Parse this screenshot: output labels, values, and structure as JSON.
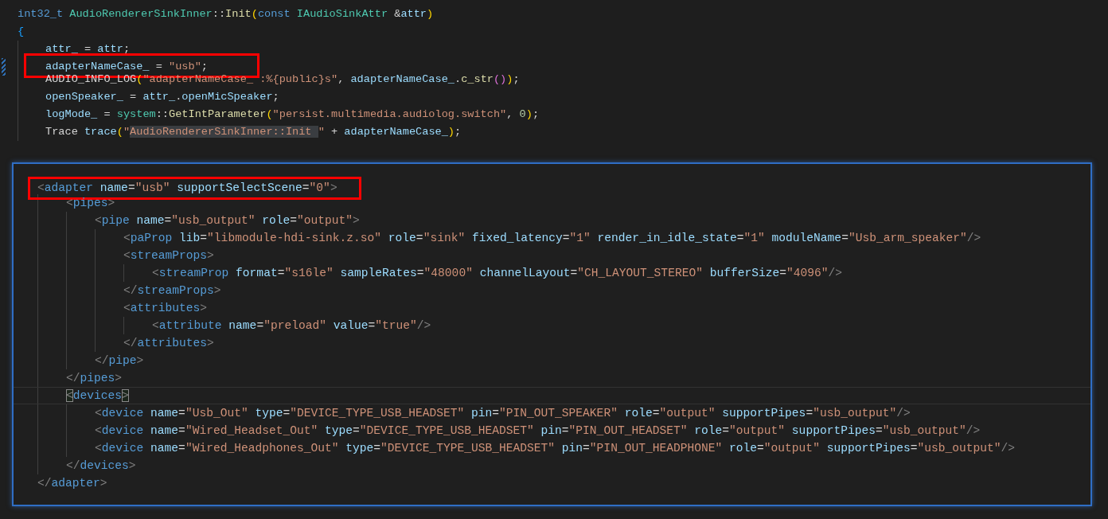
{
  "cpp_code": {
    "lines": [
      {
        "boxed": false,
        "tokens": [
          {
            "text": "int32_t ",
            "kind": "keyword"
          },
          {
            "text": "AudioRendererSinkInner",
            "kind": "type"
          },
          {
            "text": "::",
            "kind": "plain"
          },
          {
            "text": "Init",
            "kind": "function"
          },
          {
            "text": "(",
            "kind": "paren"
          },
          {
            "text": "const ",
            "kind": "keyword"
          },
          {
            "text": "IAudioSinkAttr",
            "kind": "type"
          },
          {
            "text": " &",
            "kind": "plain"
          },
          {
            "text": "attr",
            "kind": "variable"
          },
          {
            "text": ")",
            "kind": "paren"
          }
        ]
      },
      {
        "boxed": false,
        "tokens": [
          {
            "text": "{",
            "kind": "brace"
          }
        ],
        "children": [
          {
            "boxed": false,
            "tokens": [
              {
                "text": "attr_",
                "kind": "variable"
              },
              {
                "text": " = ",
                "kind": "plain"
              },
              {
                "text": "attr",
                "kind": "variable"
              },
              {
                "text": ";",
                "kind": "plain"
              }
            ]
          },
          {
            "boxed": true,
            "tokens": [
              {
                "text": "adapterNameCase_",
                "kind": "variable"
              },
              {
                "text": " = ",
                "kind": "plain"
              },
              {
                "text": "\"usb\"",
                "kind": "string"
              },
              {
                "text": ";",
                "kind": "plain"
              }
            ]
          },
          {
            "boxed": false,
            "tokens": [
              {
                "text": "AUDIO_INFO_LOG",
                "kind": "plain"
              },
              {
                "text": "(",
                "kind": "paren"
              },
              {
                "text": "\"adapterNameCase_ :%{public}s\"",
                "kind": "string"
              },
              {
                "text": ", ",
                "kind": "plain"
              },
              {
                "text": "adapterNameCase_",
                "kind": "variable"
              },
              {
                "text": ".",
                "kind": "plain"
              },
              {
                "text": "c_str",
                "kind": "function"
              },
              {
                "text": "()",
                "kind": "paren2"
              },
              {
                "text": ")",
                "kind": "paren"
              },
              {
                "text": ";",
                "kind": "plain"
              }
            ]
          },
          {
            "boxed": false,
            "tokens": [
              {
                "text": "openSpeaker_",
                "kind": "variable"
              },
              {
                "text": " = ",
                "kind": "plain"
              },
              {
                "text": "attr_",
                "kind": "variable"
              },
              {
                "text": ".",
                "kind": "plain"
              },
              {
                "text": "openMicSpeaker",
                "kind": "variable"
              },
              {
                "text": ";",
                "kind": "plain"
              }
            ]
          },
          {
            "boxed": false,
            "tokens": [
              {
                "text": "logMode_",
                "kind": "variable"
              },
              {
                "text": " = ",
                "kind": "plain"
              },
              {
                "text": "system",
                "kind": "type"
              },
              {
                "text": "::",
                "kind": "plain"
              },
              {
                "text": "GetIntParameter",
                "kind": "function"
              },
              {
                "text": "(",
                "kind": "paren"
              },
              {
                "text": "\"persist.multimedia.audiolog.switch\"",
                "kind": "string"
              },
              {
                "text": ", ",
                "kind": "plain"
              },
              {
                "text": "0",
                "kind": "number"
              },
              {
                "text": ")",
                "kind": "paren"
              },
              {
                "text": ";",
                "kind": "plain"
              }
            ]
          },
          {
            "boxed": false,
            "tokens": [
              {
                "text": "Trace ",
                "kind": "plain"
              },
              {
                "text": "trace",
                "kind": "variable"
              },
              {
                "text": "(",
                "kind": "paren"
              },
              {
                "text": "\"",
                "kind": "string"
              },
              {
                "text": "AudioRendererSinkInner::Init ",
                "kind": "match"
              },
              {
                "text": "\"",
                "kind": "string"
              },
              {
                "text": " + ",
                "kind": "plain"
              },
              {
                "text": "adapterNameCase_",
                "kind": "variable"
              },
              {
                "text": ")",
                "kind": "paren"
              },
              {
                "text": ";",
                "kind": "plain"
              }
            ]
          }
        ]
      }
    ]
  },
  "xml_code": {
    "lines": [
      {
        "boxed": true,
        "current": false,
        "tokens": [
          {
            "text": "<",
            "kind": "punct"
          },
          {
            "text": "adapter",
            "kind": "tag"
          },
          {
            "text": " name",
            "kind": "attr"
          },
          {
            "text": "=",
            "kind": "plain"
          },
          {
            "text": "\"usb\"",
            "kind": "string"
          },
          {
            "text": " supportSelectScene",
            "kind": "attr"
          },
          {
            "text": "=",
            "kind": "plain"
          },
          {
            "text": "\"0\"",
            "kind": "string"
          },
          {
            "text": ">",
            "kind": "punct"
          }
        ],
        "children": [
          {
            "boxed": false,
            "current": false,
            "tokens": [
              {
                "text": "<",
                "kind": "punct"
              },
              {
                "text": "pipes",
                "kind": "tag"
              },
              {
                "text": ">",
                "kind": "punct"
              }
            ],
            "children": [
              {
                "boxed": false,
                "current": false,
                "tokens": [
                  {
                    "text": "<",
                    "kind": "punct"
                  },
                  {
                    "text": "pipe",
                    "kind": "tag"
                  },
                  {
                    "text": " name",
                    "kind": "attr"
                  },
                  {
                    "text": "=",
                    "kind": "plain"
                  },
                  {
                    "text": "\"usb_output\"",
                    "kind": "string"
                  },
                  {
                    "text": " role",
                    "kind": "attr"
                  },
                  {
                    "text": "=",
                    "kind": "plain"
                  },
                  {
                    "text": "\"output\"",
                    "kind": "string"
                  },
                  {
                    "text": ">",
                    "kind": "punct"
                  }
                ],
                "children": [
                  {
                    "boxed": false,
                    "current": false,
                    "tokens": [
                      {
                        "text": "<",
                        "kind": "punct"
                      },
                      {
                        "text": "paProp",
                        "kind": "tag"
                      },
                      {
                        "text": " lib",
                        "kind": "attr"
                      },
                      {
                        "text": "=",
                        "kind": "plain"
                      },
                      {
                        "text": "\"libmodule-hdi-sink.z.so\"",
                        "kind": "string"
                      },
                      {
                        "text": " role",
                        "kind": "attr"
                      },
                      {
                        "text": "=",
                        "kind": "plain"
                      },
                      {
                        "text": "\"sink\"",
                        "kind": "string"
                      },
                      {
                        "text": " fixed_latency",
                        "kind": "attr"
                      },
                      {
                        "text": "=",
                        "kind": "plain"
                      },
                      {
                        "text": "\"1\"",
                        "kind": "string"
                      },
                      {
                        "text": " render_in_idle_state",
                        "kind": "attr"
                      },
                      {
                        "text": "=",
                        "kind": "plain"
                      },
                      {
                        "text": "\"1\"",
                        "kind": "string"
                      },
                      {
                        "text": " moduleName",
                        "kind": "attr"
                      },
                      {
                        "text": "=",
                        "kind": "plain"
                      },
                      {
                        "text": "\"Usb_arm_speaker\"",
                        "kind": "string"
                      },
                      {
                        "text": "/>",
                        "kind": "punct"
                      }
                    ]
                  },
                  {
                    "boxed": false,
                    "current": false,
                    "tokens": [
                      {
                        "text": "<",
                        "kind": "punct"
                      },
                      {
                        "text": "streamProps",
                        "kind": "tag"
                      },
                      {
                        "text": ">",
                        "kind": "punct"
                      }
                    ],
                    "children": [
                      {
                        "boxed": false,
                        "current": false,
                        "tokens": [
                          {
                            "text": "<",
                            "kind": "punct"
                          },
                          {
                            "text": "streamProp",
                            "kind": "tag"
                          },
                          {
                            "text": " format",
                            "kind": "attr"
                          },
                          {
                            "text": "=",
                            "kind": "plain"
                          },
                          {
                            "text": "\"s16le\"",
                            "kind": "string"
                          },
                          {
                            "text": " sampleRates",
                            "kind": "attr"
                          },
                          {
                            "text": "=",
                            "kind": "plain"
                          },
                          {
                            "text": "\"48000\"",
                            "kind": "string"
                          },
                          {
                            "text": " channelLayout",
                            "kind": "attr"
                          },
                          {
                            "text": "=",
                            "kind": "plain"
                          },
                          {
                            "text": "\"CH_LAYOUT_STEREO\"",
                            "kind": "string"
                          },
                          {
                            "text": " bufferSize",
                            "kind": "attr"
                          },
                          {
                            "text": "=",
                            "kind": "plain"
                          },
                          {
                            "text": "\"4096\"",
                            "kind": "string"
                          },
                          {
                            "text": "/>",
                            "kind": "punct"
                          }
                        ]
                      }
                    ]
                  },
                  {
                    "boxed": false,
                    "current": false,
                    "tokens": [
                      {
                        "text": "</",
                        "kind": "punct"
                      },
                      {
                        "text": "streamProps",
                        "kind": "tag"
                      },
                      {
                        "text": ">",
                        "kind": "punct"
                      }
                    ]
                  },
                  {
                    "boxed": false,
                    "current": false,
                    "tokens": [
                      {
                        "text": "<",
                        "kind": "punct"
                      },
                      {
                        "text": "attributes",
                        "kind": "tag"
                      },
                      {
                        "text": ">",
                        "kind": "punct"
                      }
                    ],
                    "children": [
                      {
                        "boxed": false,
                        "current": false,
                        "tokens": [
                          {
                            "text": "<",
                            "kind": "punct"
                          },
                          {
                            "text": "attribute",
                            "kind": "tag"
                          },
                          {
                            "text": " name",
                            "kind": "attr"
                          },
                          {
                            "text": "=",
                            "kind": "plain"
                          },
                          {
                            "text": "\"preload\"",
                            "kind": "string"
                          },
                          {
                            "text": " value",
                            "kind": "attr"
                          },
                          {
                            "text": "=",
                            "kind": "plain"
                          },
                          {
                            "text": "\"true\"",
                            "kind": "string"
                          },
                          {
                            "text": "/>",
                            "kind": "punct"
                          }
                        ]
                      }
                    ]
                  },
                  {
                    "boxed": false,
                    "current": false,
                    "tokens": [
                      {
                        "text": "</",
                        "kind": "punct"
                      },
                      {
                        "text": "attributes",
                        "kind": "tag"
                      },
                      {
                        "text": ">",
                        "kind": "punct"
                      }
                    ]
                  }
                ]
              },
              {
                "boxed": false,
                "current": false,
                "tokens": [
                  {
                    "text": "</",
                    "kind": "punct"
                  },
                  {
                    "text": "pipe",
                    "kind": "tag"
                  },
                  {
                    "text": ">",
                    "kind": "punct"
                  }
                ]
              }
            ]
          },
          {
            "boxed": false,
            "current": false,
            "tokens": [
              {
                "text": "</",
                "kind": "punct"
              },
              {
                "text": "pipes",
                "kind": "tag"
              },
              {
                "text": ">",
                "kind": "punct"
              }
            ]
          },
          {
            "boxed": false,
            "current": true,
            "tokens": [
              {
                "text": "<",
                "kind": "bracket-match"
              },
              {
                "text": "devices",
                "kind": "tag"
              },
              {
                "text": ">",
                "kind": "bracket-match"
              }
            ],
            "children": [
              {
                "boxed": false,
                "current": false,
                "tokens": [
                  {
                    "text": "<",
                    "kind": "punct"
                  },
                  {
                    "text": "device",
                    "kind": "tag"
                  },
                  {
                    "text": " name",
                    "kind": "attr"
                  },
                  {
                    "text": "=",
                    "kind": "plain"
                  },
                  {
                    "text": "\"Usb_Out\"",
                    "kind": "string"
                  },
                  {
                    "text": " type",
                    "kind": "attr"
                  },
                  {
                    "text": "=",
                    "kind": "plain"
                  },
                  {
                    "text": "\"DEVICE_TYPE_USB_HEADSET\"",
                    "kind": "string"
                  },
                  {
                    "text": " pin",
                    "kind": "attr"
                  },
                  {
                    "text": "=",
                    "kind": "plain"
                  },
                  {
                    "text": "\"PIN_OUT_SPEAKER\"",
                    "kind": "string"
                  },
                  {
                    "text": " role",
                    "kind": "attr"
                  },
                  {
                    "text": "=",
                    "kind": "plain"
                  },
                  {
                    "text": "\"output\"",
                    "kind": "string"
                  },
                  {
                    "text": " supportPipes",
                    "kind": "attr"
                  },
                  {
                    "text": "=",
                    "kind": "plain"
                  },
                  {
                    "text": "\"usb_output\"",
                    "kind": "string"
                  },
                  {
                    "text": "/>",
                    "kind": "punct"
                  }
                ]
              },
              {
                "boxed": false,
                "current": false,
                "tokens": [
                  {
                    "text": "<",
                    "kind": "punct"
                  },
                  {
                    "text": "device",
                    "kind": "tag"
                  },
                  {
                    "text": " name",
                    "kind": "attr"
                  },
                  {
                    "text": "=",
                    "kind": "plain"
                  },
                  {
                    "text": "\"Wired_Headset_Out\"",
                    "kind": "string"
                  },
                  {
                    "text": " type",
                    "kind": "attr"
                  },
                  {
                    "text": "=",
                    "kind": "plain"
                  },
                  {
                    "text": "\"DEVICE_TYPE_USB_HEADSET\"",
                    "kind": "string"
                  },
                  {
                    "text": " pin",
                    "kind": "attr"
                  },
                  {
                    "text": "=",
                    "kind": "plain"
                  },
                  {
                    "text": "\"PIN_OUT_HEADSET\"",
                    "kind": "string"
                  },
                  {
                    "text": " role",
                    "kind": "attr"
                  },
                  {
                    "text": "=",
                    "kind": "plain"
                  },
                  {
                    "text": "\"output\"",
                    "kind": "string"
                  },
                  {
                    "text": " supportPipes",
                    "kind": "attr"
                  },
                  {
                    "text": "=",
                    "kind": "plain"
                  },
                  {
                    "text": "\"usb_output\"",
                    "kind": "string"
                  },
                  {
                    "text": "/>",
                    "kind": "punct"
                  }
                ]
              },
              {
                "boxed": false,
                "current": false,
                "tokens": [
                  {
                    "text": "<",
                    "kind": "punct"
                  },
                  {
                    "text": "device",
                    "kind": "tag"
                  },
                  {
                    "text": " name",
                    "kind": "attr"
                  },
                  {
                    "text": "=",
                    "kind": "plain"
                  },
                  {
                    "text": "\"Wired_Headphones_Out\"",
                    "kind": "string"
                  },
                  {
                    "text": " type",
                    "kind": "attr"
                  },
                  {
                    "text": "=",
                    "kind": "plain"
                  },
                  {
                    "text": "\"DEVICE_TYPE_USB_HEADSET\"",
                    "kind": "string"
                  },
                  {
                    "text": " pin",
                    "kind": "attr"
                  },
                  {
                    "text": "=",
                    "kind": "plain"
                  },
                  {
                    "text": "\"PIN_OUT_HEADPHONE\"",
                    "kind": "string"
                  },
                  {
                    "text": " role",
                    "kind": "attr"
                  },
                  {
                    "text": "=",
                    "kind": "plain"
                  },
                  {
                    "text": "\"output\"",
                    "kind": "string"
                  },
                  {
                    "text": " supportPipes",
                    "kind": "attr"
                  },
                  {
                    "text": "=",
                    "kind": "plain"
                  },
                  {
                    "text": "\"usb_output\"",
                    "kind": "string"
                  },
                  {
                    "text": "/>",
                    "kind": "punct"
                  }
                ]
              }
            ]
          },
          {
            "boxed": false,
            "current": false,
            "tokens": [
              {
                "text": "</",
                "kind": "punct"
              },
              {
                "text": "devices",
                "kind": "tag"
              },
              {
                "text": ">",
                "kind": "punct"
              }
            ]
          }
        ]
      },
      {
        "boxed": false,
        "current": false,
        "tokens": [
          {
            "text": "</",
            "kind": "punct"
          },
          {
            "text": "adapter",
            "kind": "tag"
          },
          {
            "text": ">",
            "kind": "punct"
          }
        ]
      }
    ]
  }
}
